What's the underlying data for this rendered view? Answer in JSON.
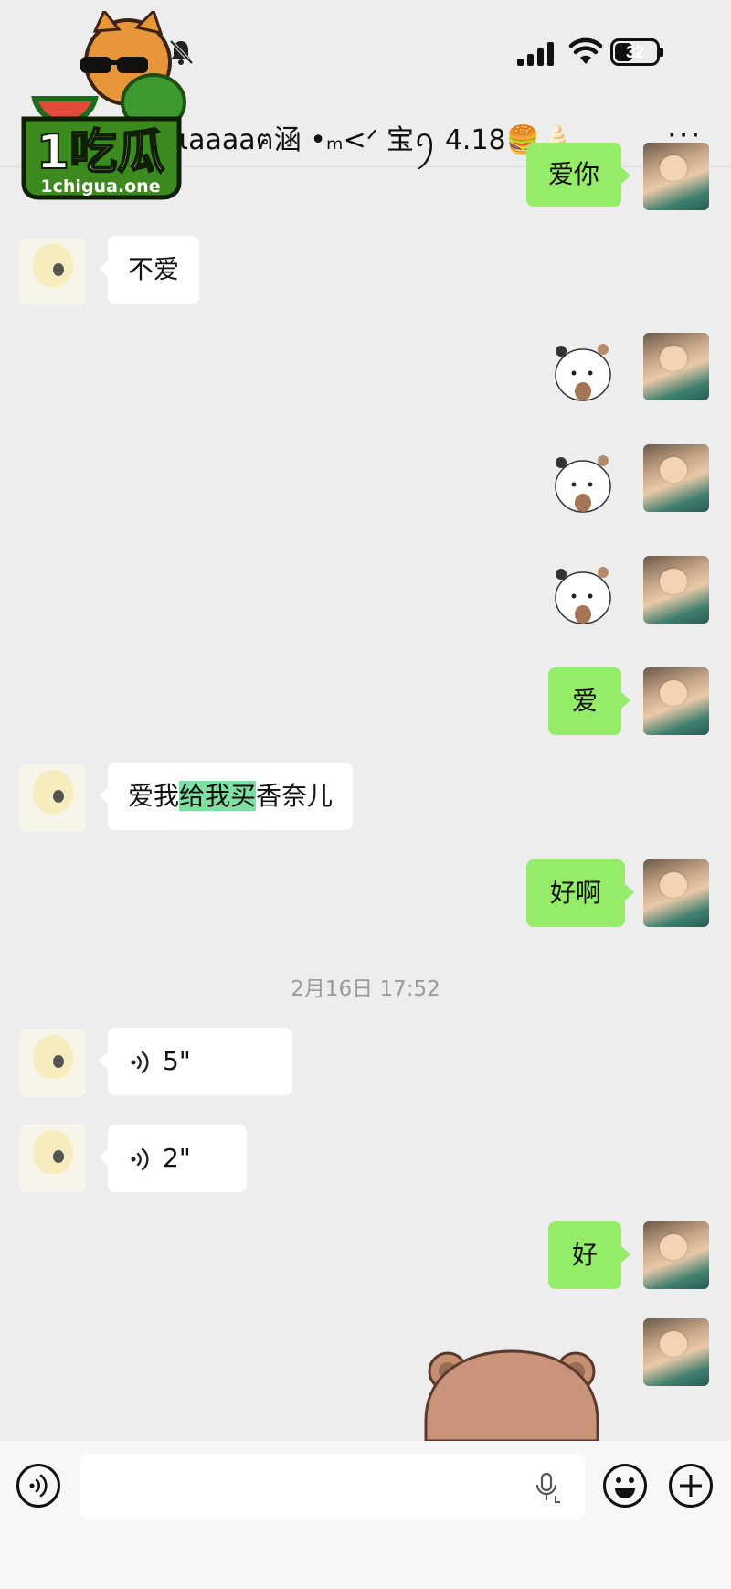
{
  "status_bar": {
    "battery": "32",
    "signal": "signal-icon",
    "wifi": "wifi-icon",
    "mute": "mute-bell-icon"
  },
  "header": {
    "title": "ιaaaaฅ涵 •ₘ<ᐟ 宝ꪆ 4.18🍔🍦",
    "more_label": "···"
  },
  "watermark": {
    "logo_text": "1吃瓜",
    "site": "1chigua.one"
  },
  "messages": [
    {
      "from": "me",
      "type": "text",
      "text": "爱你"
    },
    {
      "from": "her",
      "type": "text",
      "text": "不爱"
    },
    {
      "from": "me",
      "type": "sticker",
      "sticker": "white-bear-sticker"
    },
    {
      "from": "me",
      "type": "sticker",
      "sticker": "white-bear-sticker"
    },
    {
      "from": "me",
      "type": "sticker",
      "sticker": "white-bear-sticker"
    },
    {
      "from": "me",
      "type": "text",
      "text": "爱"
    },
    {
      "from": "her",
      "type": "text",
      "parts": [
        "爱我",
        "给我买",
        "香奈儿"
      ],
      "highlighted_part": 1
    },
    {
      "from": "me",
      "type": "text",
      "text": "好啊"
    },
    {
      "from": "system",
      "type": "timestamp",
      "text": "2月16日 17:52"
    },
    {
      "from": "her",
      "type": "voice",
      "duration": "5\""
    },
    {
      "from": "her",
      "type": "voice",
      "duration": "2\""
    },
    {
      "from": "me",
      "type": "text",
      "text": "好"
    },
    {
      "from": "me",
      "type": "sticker",
      "sticker": "brown-bear-sticker"
    }
  ],
  "input_bar": {
    "placeholder": "",
    "voice": "voice-mode-icon",
    "mic": "mic-icon",
    "emoji": "emoji-icon",
    "plus": "plus-icon"
  },
  "colors": {
    "background": "#ededed",
    "my_bubble": "#95ec69",
    "their_bubble": "#ffffff",
    "highlight": "#7ee0a2"
  }
}
